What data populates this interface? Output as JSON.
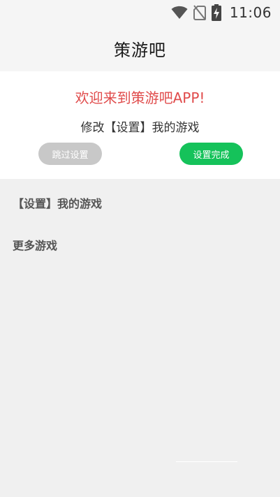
{
  "status_bar": {
    "time": "11:06",
    "icons": [
      "wifi-icon",
      "no-sim-icon",
      "battery-charging-icon"
    ]
  },
  "app_bar": {
    "title": "策游吧"
  },
  "welcome": {
    "title": "欢迎来到策游吧APP!",
    "subtitle": "修改【设置】我的游戏",
    "skip_label": "跳过设置",
    "done_label": "设置完成"
  },
  "sections": {
    "my_games": "【设置】我的游戏",
    "more_games": "更多游戏"
  },
  "colors": {
    "accent_green": "#15c25a",
    "welcome_red": "#e04b4b",
    "skip_gray": "#c8c8c8",
    "background": "#f0f0f0"
  }
}
